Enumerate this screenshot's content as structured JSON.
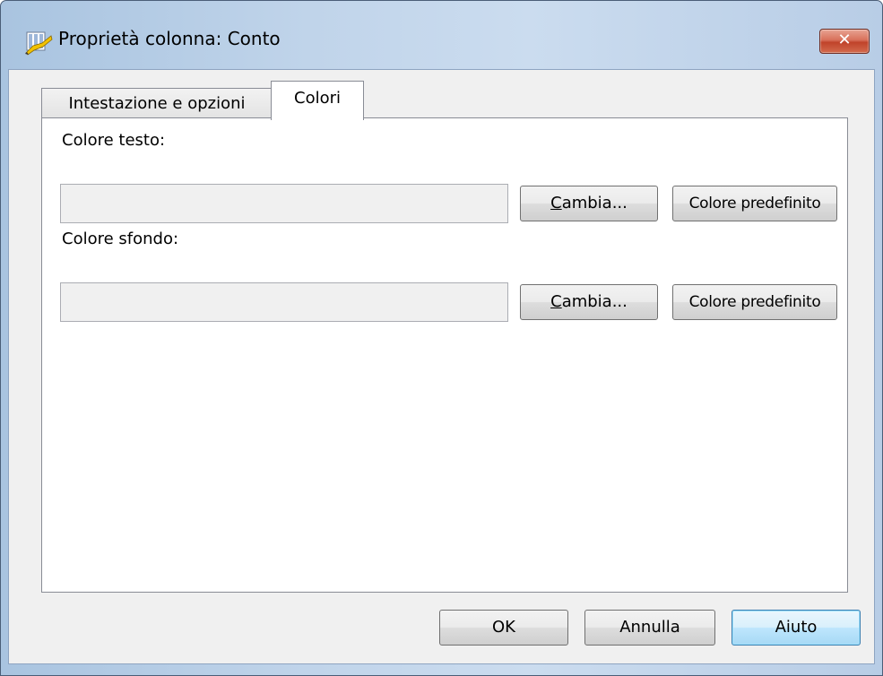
{
  "window": {
    "title": "Proprietà colonna: Conto",
    "close_glyph": "✕",
    "app_icon": "column-properties-icon"
  },
  "tabs": [
    {
      "label": "Intestazione e opzioni",
      "active": false
    },
    {
      "label": "Colori",
      "active": true
    }
  ],
  "colors_tab": {
    "text_color": {
      "label": "Colore testo:",
      "change_button": {
        "mnemonic": "C",
        "rest": "ambia..."
      },
      "default_button": "Colore predefinito"
    },
    "background_color": {
      "label": "Colore sfondo:",
      "change_button": {
        "mnemonic": "C",
        "rest": "ambia..."
      },
      "default_button": "Colore predefinito"
    }
  },
  "footer": {
    "ok": "OK",
    "cancel": "Annulla",
    "help": "Aiuto"
  },
  "theme": {
    "focus_accent": "#3c7fb1",
    "close_button": "#c0432a"
  }
}
